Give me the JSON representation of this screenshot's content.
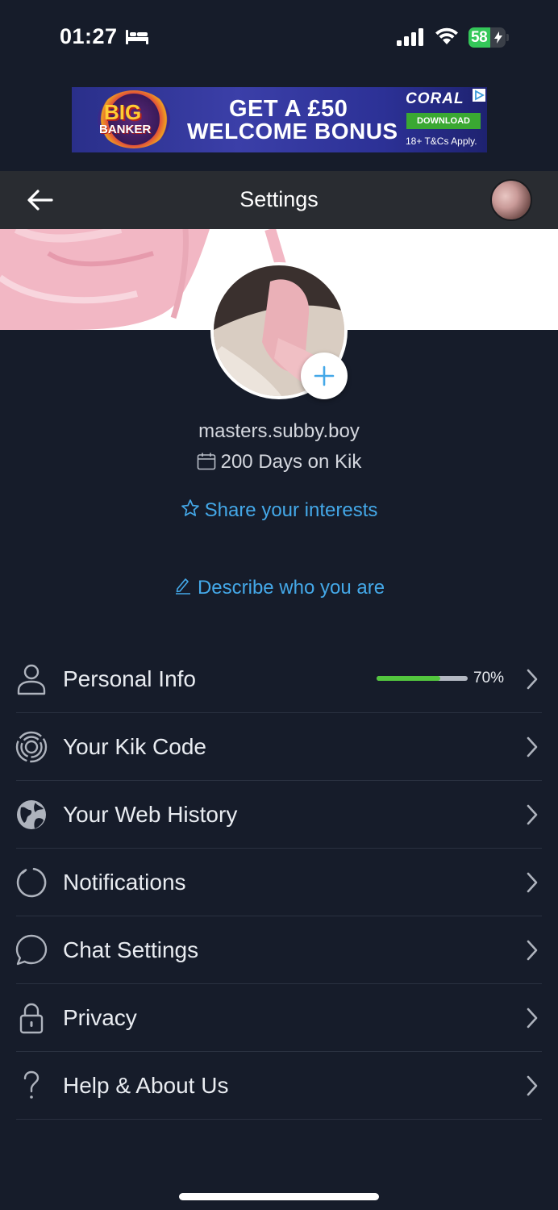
{
  "status_bar": {
    "time": "01:27",
    "battery_percent": "58",
    "battery_level": 0.58,
    "icons": [
      "sleep-focus-icon",
      "cellular-signal-icon",
      "wifi-icon",
      "battery-charging-icon"
    ]
  },
  "ad": {
    "logo_line_1": "BIG",
    "logo_line_2": "BANKER",
    "headline_1": "GET A £50",
    "headline_2": "WELCOME BONUS",
    "brand": "CORAL",
    "cta": "DOWNLOAD",
    "terms": "18+ T&Cs Apply."
  },
  "header": {
    "title": "Settings",
    "back_icon": "arrow-left-icon"
  },
  "profile": {
    "username": "masters.subby.boy",
    "days_on_kik": "200 Days on Kik",
    "share_interests": "Share your interests",
    "describe": "Describe who you are"
  },
  "menu": {
    "items": [
      {
        "label": "Personal Info",
        "icon": "person-icon",
        "progress_percent": 70,
        "progress_label": "70%"
      },
      {
        "label": "Your Kik Code",
        "icon": "kik-code-icon"
      },
      {
        "label": "Your Web History",
        "icon": "globe-icon"
      },
      {
        "label": "Notifications",
        "icon": "notifications-icon"
      },
      {
        "label": "Chat Settings",
        "icon": "chat-bubble-icon"
      },
      {
        "label": "Privacy",
        "icon": "lock-icon"
      },
      {
        "label": "Help & About Us",
        "icon": "help-icon"
      }
    ]
  },
  "colors": {
    "background": "#161c2a",
    "nav_bar": "#292c31",
    "link": "#44a8e8",
    "progress": "#53c63e",
    "battery": "#34c759"
  }
}
